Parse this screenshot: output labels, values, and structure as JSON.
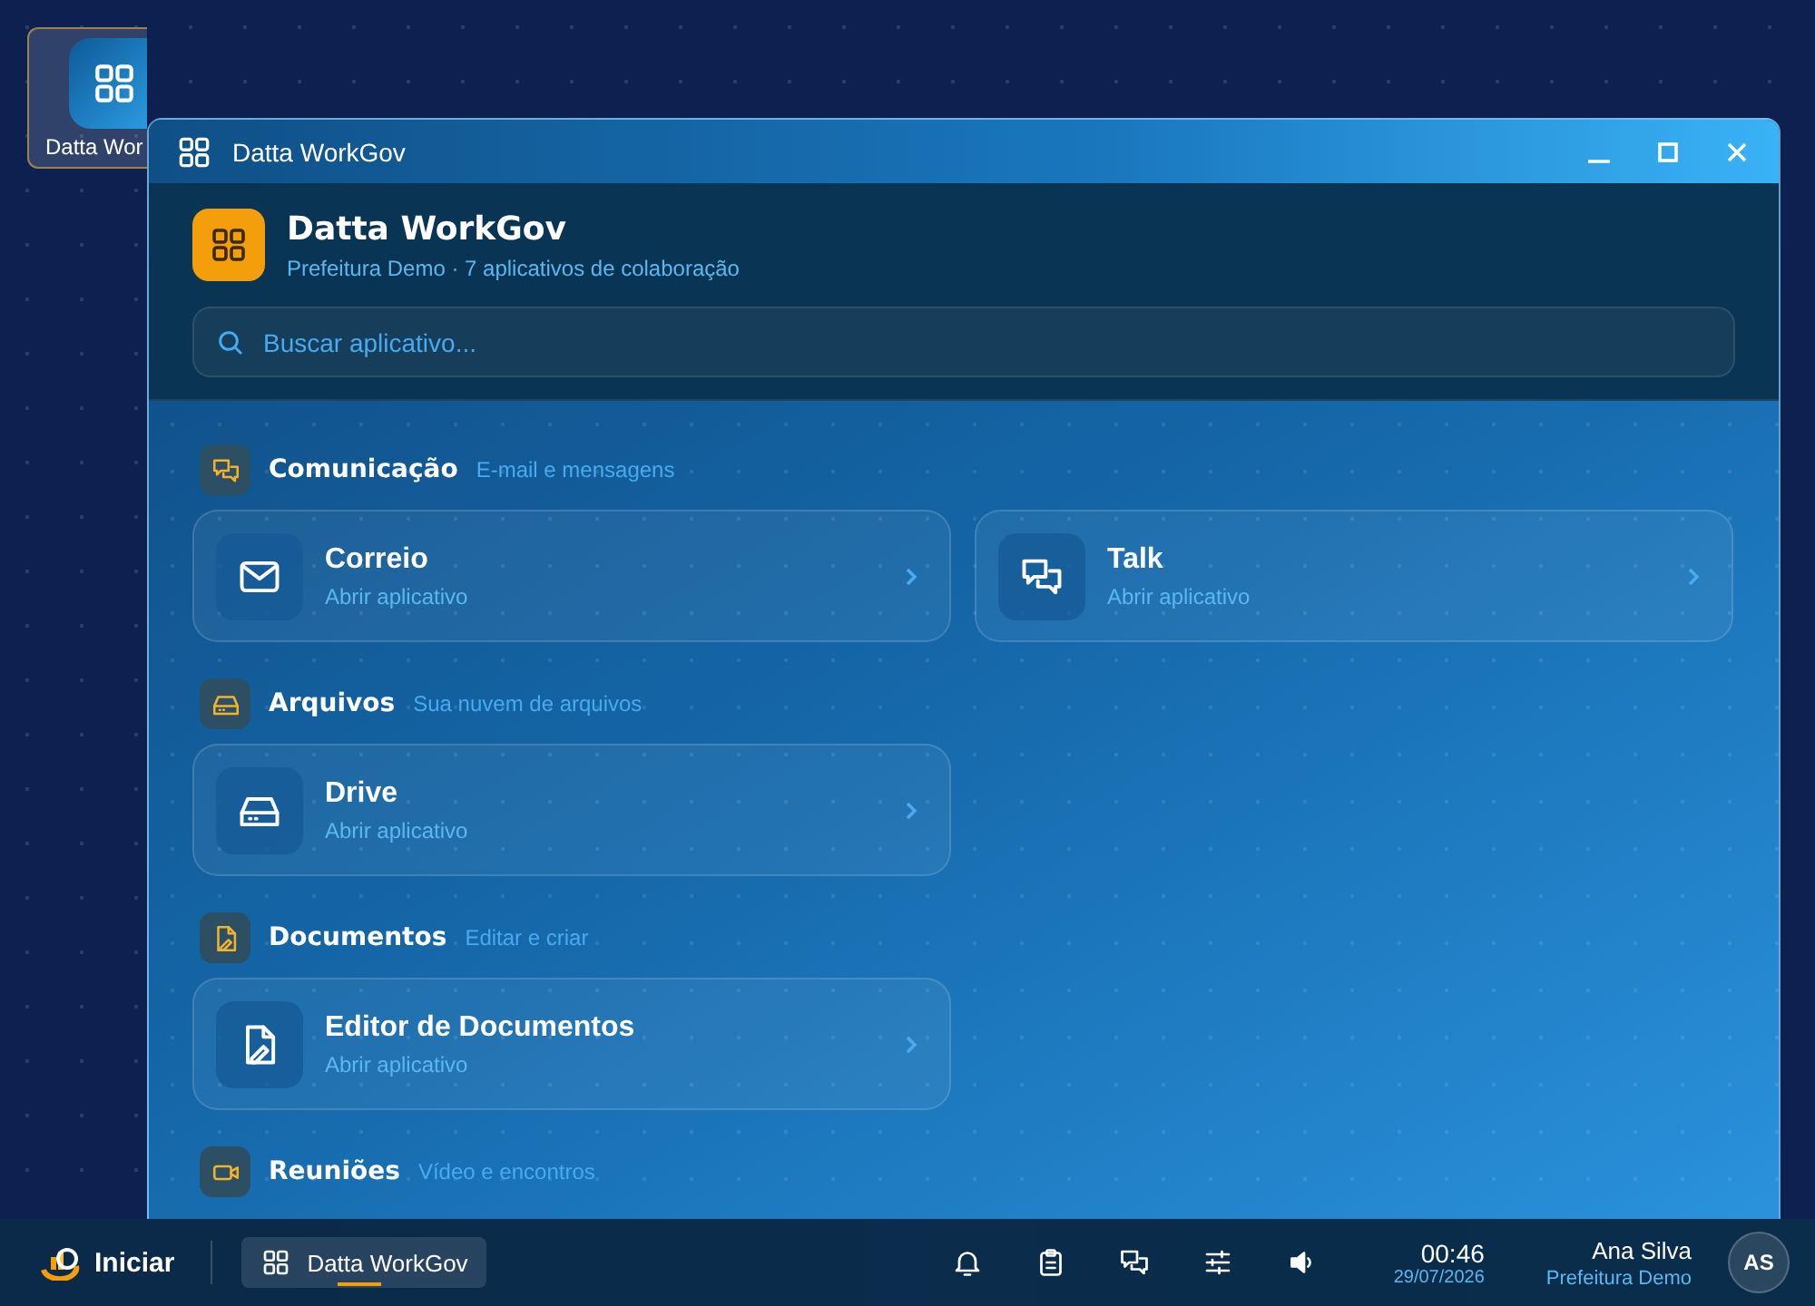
{
  "desktop_icons": [
    {
      "label": "Datta Wor",
      "selected": true
    }
  ],
  "window": {
    "title": "Datta WorkGov",
    "app_name": "Datta WorkGov",
    "subtitle": "Prefeitura Demo · 7 aplicativos de colaboração",
    "search": {
      "placeholder": "Buscar aplicativo..."
    },
    "sections": [
      {
        "kind": "chat",
        "title": "Comunicação",
        "subtitle": "E-mail e mensagens",
        "apps": [
          {
            "kind": "mail",
            "name": "Correio",
            "action": "Abrir aplicativo"
          },
          {
            "kind": "chat",
            "name": "Talk",
            "action": "Abrir aplicativo"
          }
        ]
      },
      {
        "kind": "drive",
        "title": "Arquivos",
        "subtitle": "Sua nuvem de arquivos",
        "apps": [
          {
            "kind": "drive",
            "name": "Drive",
            "action": "Abrir aplicativo"
          }
        ]
      },
      {
        "kind": "doc",
        "title": "Documentos",
        "subtitle": "Editar e criar",
        "apps": [
          {
            "kind": "doc",
            "name": "Editor de Documentos",
            "action": "Abrir aplicativo"
          }
        ]
      },
      {
        "kind": "video",
        "title": "Reuniões",
        "subtitle": "Vídeo e encontros"
      }
    ]
  },
  "taskbar": {
    "start": "Iniciar",
    "tasks": [
      {
        "label": "Datta WorkGov",
        "selected": true
      }
    ],
    "tray": [
      {
        "kind": "bell"
      },
      {
        "kind": "clipboard"
      },
      {
        "kind": "chat"
      },
      {
        "kind": "sliders"
      },
      {
        "kind": "speaker"
      }
    ],
    "time": "00:46",
    "date": "29/07/2026",
    "user": "Ana Silva",
    "org": "Prefeitura Demo",
    "avatar": "AS"
  }
}
